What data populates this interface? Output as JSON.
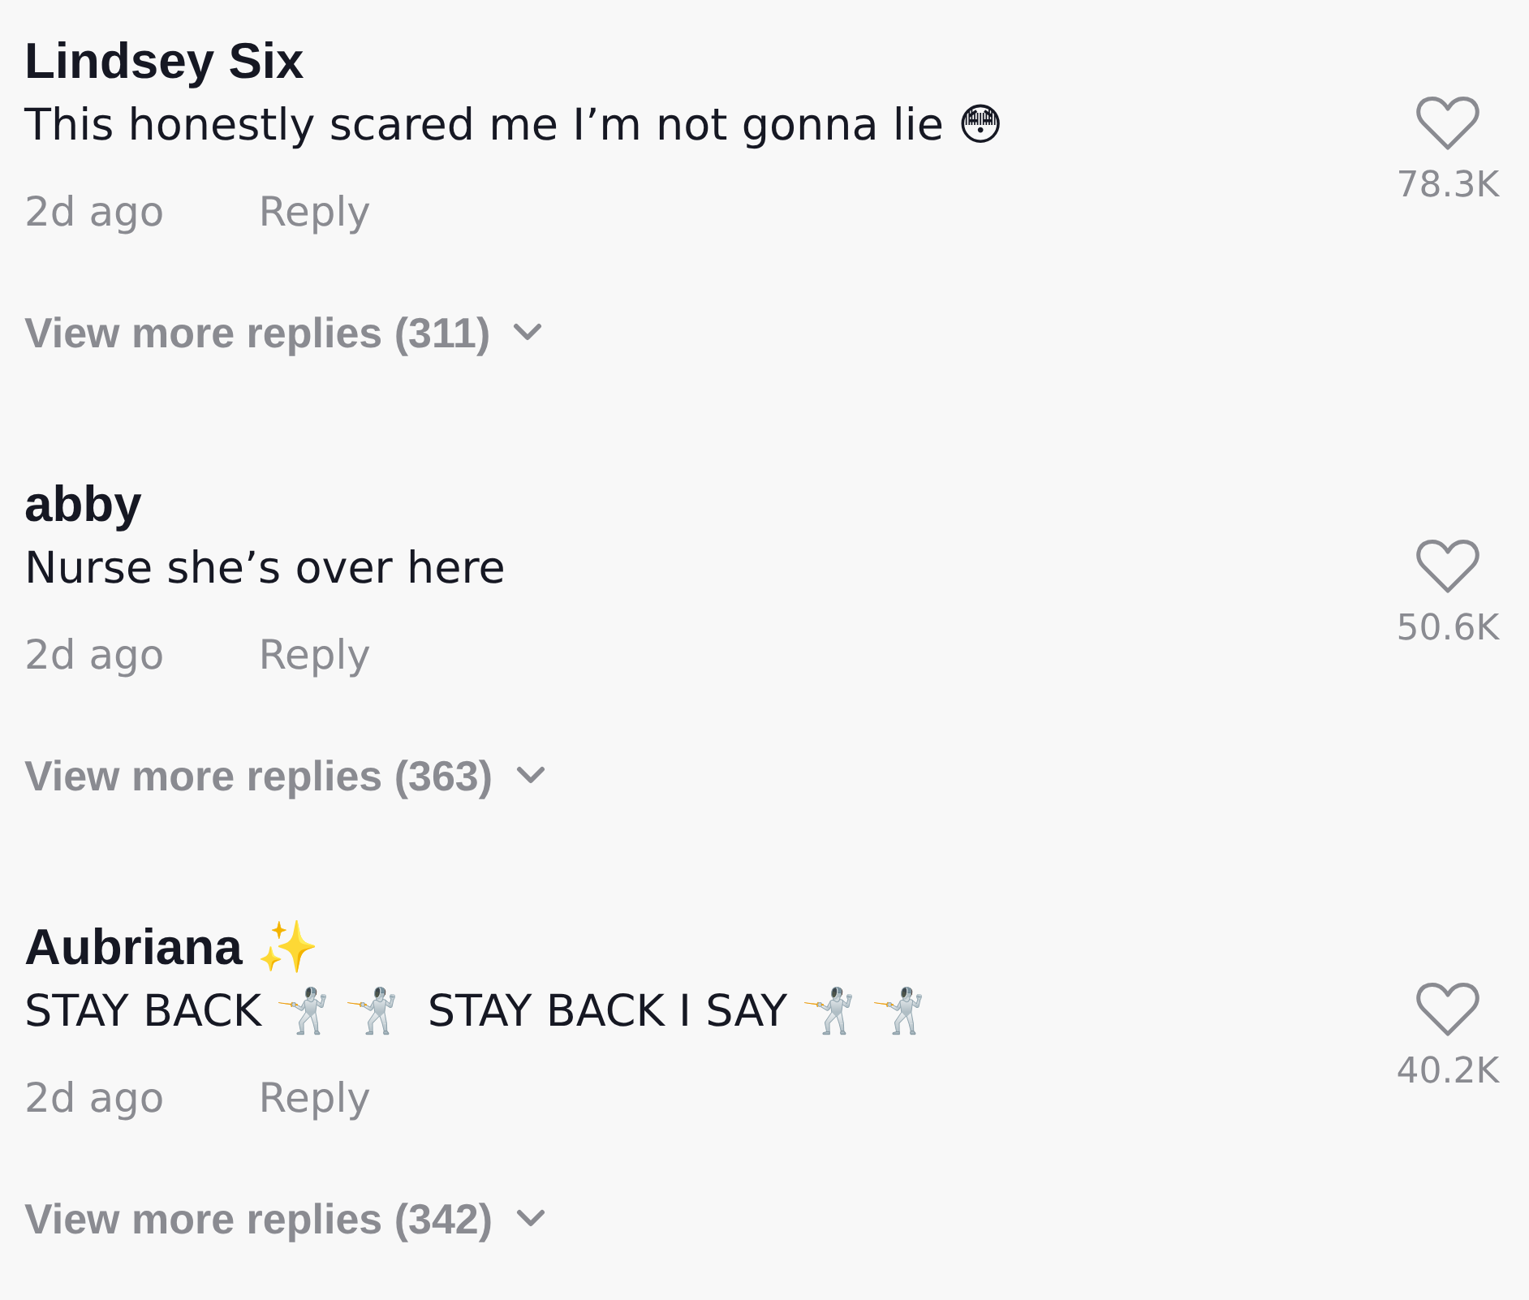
{
  "comments": [
    {
      "author": "Lindsey Six",
      "text": "This honestly scared me I’m not gonna lie 😳",
      "time": "2d ago",
      "reply": "Reply",
      "replies": "View more replies (311)",
      "likes": "78.3K",
      "liked": false
    },
    {
      "author": "abby",
      "text": "Nurse she’s over here",
      "time": "2d ago",
      "reply": "Reply",
      "replies": "View more replies (363)",
      "likes": "50.6K",
      "liked": false
    },
    {
      "author": "Aubriana ✨",
      "text": "STAY BACK 🤺 🤺  STAY BACK I SAY 🤺 🤺",
      "time": "2d ago",
      "reply": "Reply",
      "replies": "View more replies (342)",
      "likes": "40.2K",
      "liked": false
    }
  ]
}
